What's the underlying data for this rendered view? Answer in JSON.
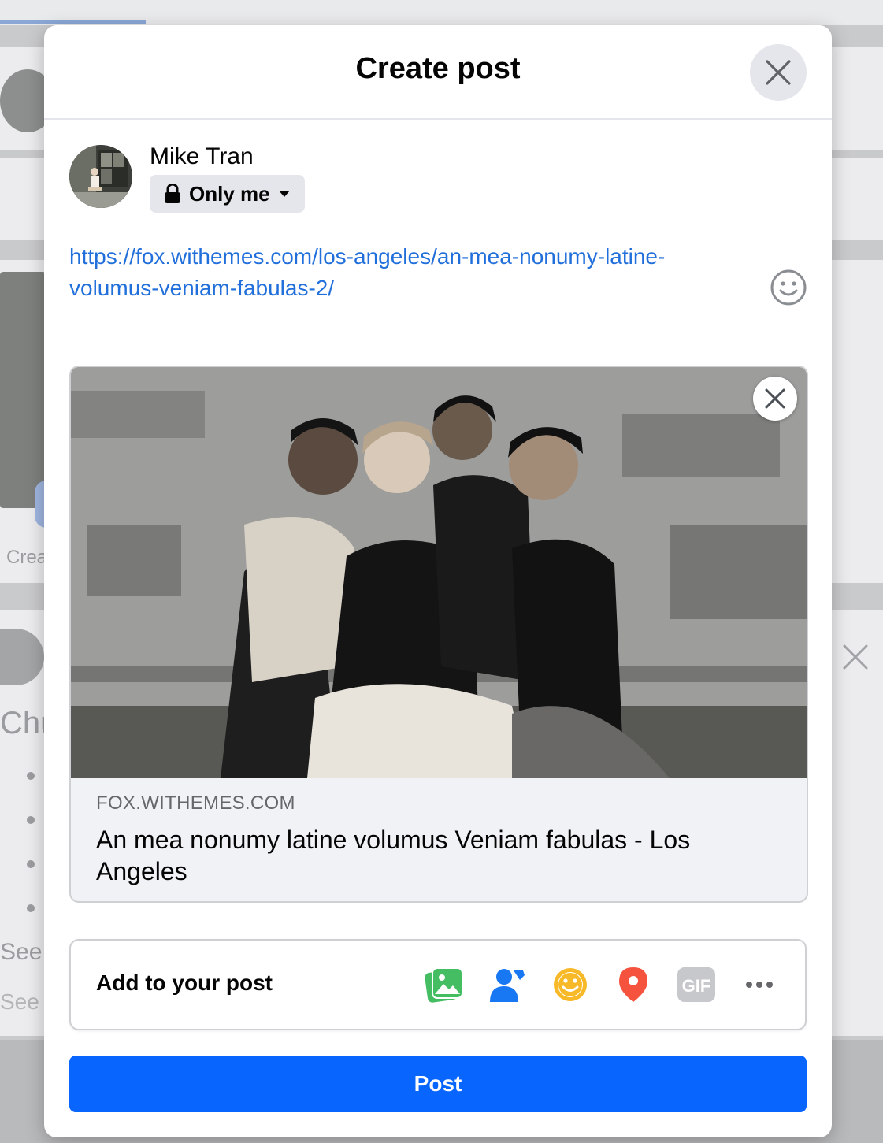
{
  "background": {
    "create_partial": "Crea",
    "heading_partial": "Chu",
    "see_partial_1": "See",
    "see_partial_2": "See"
  },
  "modal": {
    "title": "Create post",
    "close_icon": "close-icon"
  },
  "user": {
    "name": "Mike Tran",
    "audience": "Only me",
    "audience_icon": "lock-icon"
  },
  "composer": {
    "text": "https://fox.withemes.com/los-angeles/an-mea-nonumy-latine-volumus-veniam-fabulas-2/"
  },
  "link_preview": {
    "domain": "FOX.WITHEMES.COM",
    "title": "An mea nonumy latine volumus Veniam fabulas - Los Angeles"
  },
  "add_to_post": {
    "label": "Add to your post",
    "icons": [
      "photo-video-icon",
      "tag-people-icon",
      "feeling-icon",
      "check-in-icon",
      "gif-icon",
      "more-icon"
    ],
    "gif_label": "GIF"
  },
  "post_button": {
    "label": "Post",
    "color": "#0866ff"
  },
  "colors": {
    "link": "#216fdb",
    "photo_icon": "#45bd62",
    "tag_icon": "#1877f2",
    "feeling_icon": "#f7b928",
    "checkin_icon": "#f5533d",
    "gif_icon": "#c6c8cb"
  }
}
